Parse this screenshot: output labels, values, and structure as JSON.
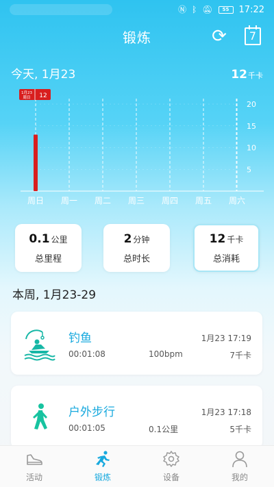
{
  "status_bar": {
    "time": "17:22",
    "battery": "55",
    "icons": [
      "nfc-icon",
      "bluetooth-icon",
      "mute-icon",
      "battery-icon"
    ]
  },
  "header": {
    "title": "锻炼",
    "actions": [
      "refresh-icon",
      "calendar-icon"
    ],
    "calendar_day": "7"
  },
  "today": {
    "label": "今天, 1月23",
    "calories_value": "12",
    "calories_unit": "千卡"
  },
  "chart_data": {
    "type": "bar",
    "categories": [
      "周日",
      "周一",
      "周二",
      "周三",
      "周四",
      "周五",
      "周六"
    ],
    "values": [
      13,
      0,
      0,
      0,
      0,
      0,
      0
    ],
    "ylim": [
      0,
      20
    ],
    "yticks": [
      5,
      10,
      15,
      20
    ],
    "highlight_label": {
      "date_line1": "1月23",
      "date_line2": "周日",
      "value": "12"
    },
    "colors": {
      "bar": "#d81e1e",
      "grid": "#ffffff",
      "tick_text": "#ffffff"
    }
  },
  "stats": [
    {
      "value": "0.1",
      "unit": "公里",
      "label": "总里程"
    },
    {
      "value": "2",
      "unit": "分钟",
      "label": "总时长"
    },
    {
      "value": "12",
      "unit": "千卡",
      "label": "总消耗"
    }
  ],
  "week": {
    "title": "本周, 1月23-29"
  },
  "records": [
    {
      "name": "钓鱼",
      "icon": "fishing-icon",
      "datetime": "1月23 17:19",
      "duration": "00:01:08",
      "metric": "100bpm",
      "calories": "7千卡"
    },
    {
      "name": "户外步行",
      "icon": "walking-icon",
      "datetime": "1月23 17:18",
      "duration": "00:01:05",
      "metric": "0.1公里",
      "calories": "5千卡"
    }
  ],
  "tabs": [
    {
      "label": "活动",
      "icon": "shoe-icon",
      "active": false
    },
    {
      "label": "锻炼",
      "icon": "runner-icon",
      "active": true
    },
    {
      "label": "设备",
      "icon": "gear-icon",
      "active": false
    },
    {
      "label": "我的",
      "icon": "person-icon",
      "active": false
    }
  ],
  "colors": {
    "accent": "#18a9de",
    "header_bg": "#2fc3f0",
    "bar_red": "#d81e1e"
  }
}
